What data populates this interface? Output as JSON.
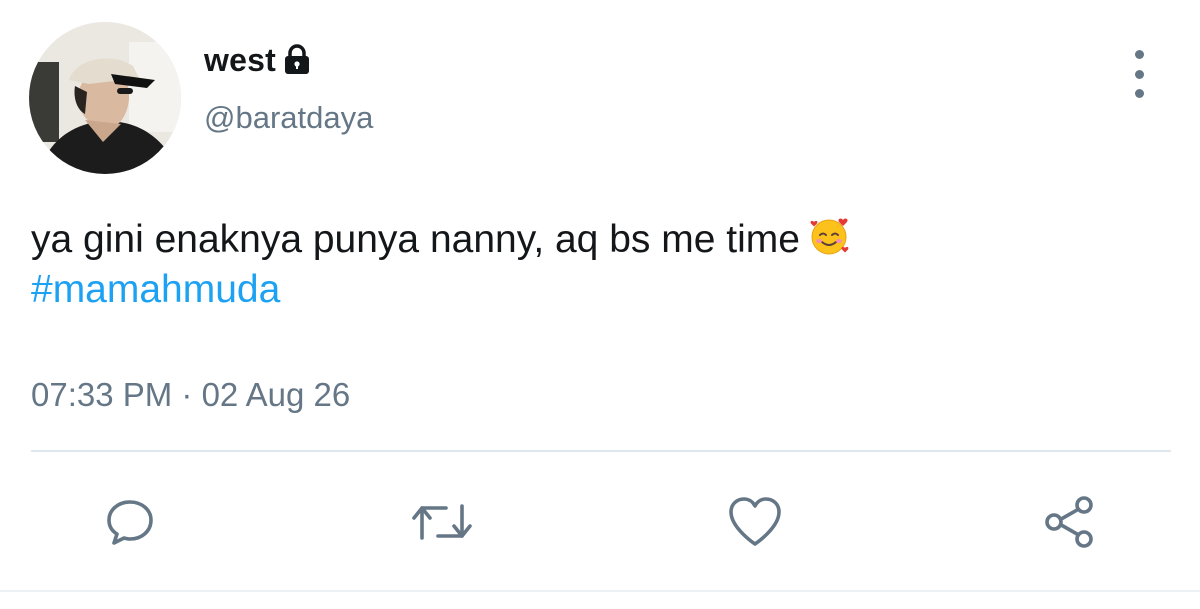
{
  "user": {
    "display_name": "west",
    "handle": "@baratdaya",
    "protected_icon": "lock-icon",
    "avatar": "profile-photo"
  },
  "tweet": {
    "text": "ya gini enaknya punya nanny, aq bs me time",
    "emoji": "smiling-face-with-hearts",
    "hashtag": "#mamahmuda",
    "timestamp": "07:33 PM · 02 Aug 26"
  },
  "actions": [
    {
      "name": "reply",
      "icon": "speech-bubble-icon"
    },
    {
      "name": "retweet",
      "icon": "retweet-icon"
    },
    {
      "name": "like",
      "icon": "heart-icon"
    },
    {
      "name": "share",
      "icon": "share-icon"
    }
  ],
  "colors": {
    "text": "#14171a",
    "secondary": "#657786",
    "accent": "#1da1f2",
    "divider": "#e1e8ed"
  }
}
